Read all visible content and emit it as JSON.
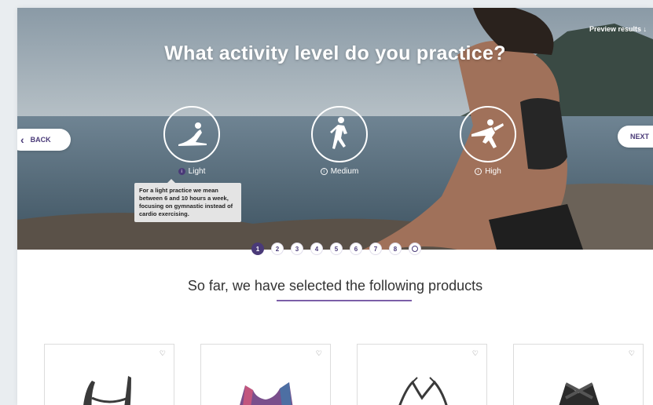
{
  "hero": {
    "title": "What activity level do you practice?",
    "preview_link": "Preview results ↓",
    "back_label": "BACK",
    "back_icon": "chevron-left-icon",
    "next_label": "NEXT"
  },
  "options": [
    {
      "label": "Light",
      "icon": "yoga-pose-icon",
      "selected": true
    },
    {
      "label": "Medium",
      "icon": "runner-icon",
      "selected": false
    },
    {
      "label": "High",
      "icon": "kick-icon",
      "selected": false
    }
  ],
  "tooltip": {
    "text": "For a light practice we mean between 6 and 10 hours a week, focusing on gymnastic instead of cardio exercising."
  },
  "steps": [
    "1",
    "2",
    "3",
    "4",
    "5",
    "6",
    "7",
    "8"
  ],
  "active_step": 1,
  "products_section": {
    "title": "So far, we have selected the following products"
  },
  "products": [
    {
      "icon": "heart-icon"
    },
    {
      "icon": "heart-icon"
    },
    {
      "icon": "heart-icon"
    },
    {
      "icon": "heart-icon"
    }
  ],
  "colors": {
    "accent": "#4a3a78",
    "underline": "#7b5fa8"
  }
}
